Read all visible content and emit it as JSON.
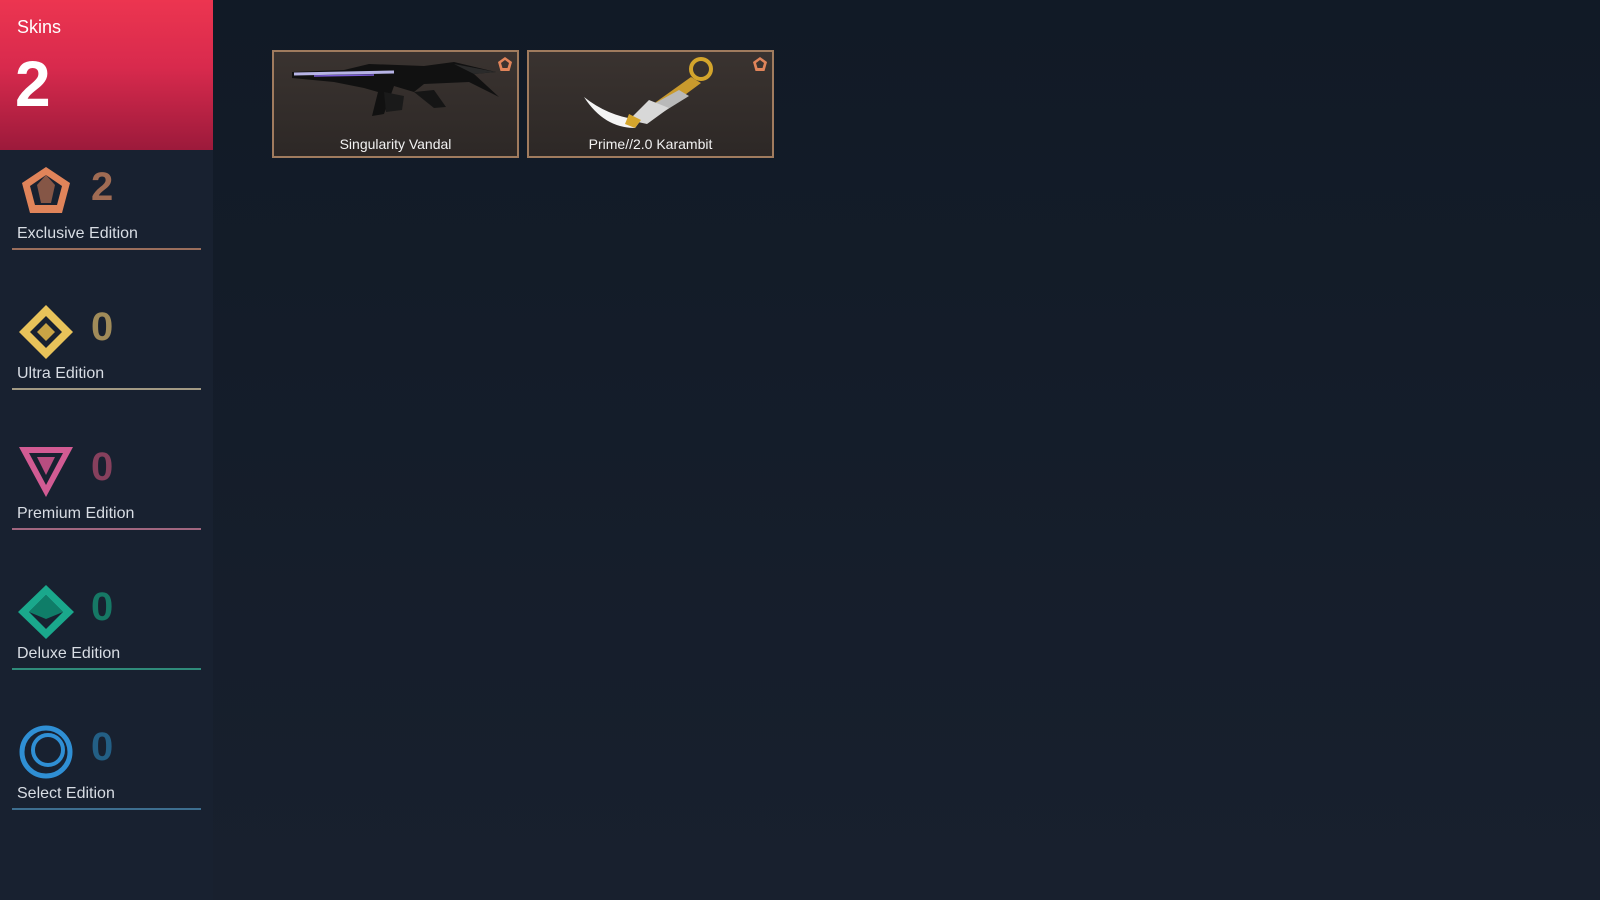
{
  "header": {
    "title": "Skins",
    "count": "2"
  },
  "tiers": [
    {
      "label": "Exclusive Edition",
      "count": "2",
      "icon": "exclusive-edition-icon",
      "color": "#e0845a",
      "count_color": "#9f6b53",
      "line_color": "#9a6e5c"
    },
    {
      "label": "Ultra Edition",
      "count": "0",
      "icon": "ultra-edition-icon",
      "color": "#e8c35a",
      "count_color": "#a08b59",
      "line_color": "#a29a84"
    },
    {
      "label": "Premium Edition",
      "count": "0",
      "icon": "premium-edition-icon",
      "color": "#d25b93",
      "count_color": "#86405d",
      "line_color": "#a0667f"
    },
    {
      "label": "Deluxe Edition",
      "count": "0",
      "icon": "deluxe-edition-icon",
      "color": "#1aa88c",
      "count_color": "#167865",
      "line_color": "#2f8b7a"
    },
    {
      "label": "Select Edition",
      "count": "0",
      "icon": "select-edition-icon",
      "color": "#2f8fd4",
      "count_color": "#235f85",
      "line_color": "#3d6e8f"
    }
  ],
  "skins": [
    {
      "name": "Singularity Vandal",
      "icon": "vandal-rifle-image",
      "tier_icon": "exclusive-edition-icon"
    },
    {
      "name": "Prime//2.0 Karambit",
      "icon": "karambit-knife-image",
      "tier_icon": "exclusive-edition-icon"
    }
  ]
}
